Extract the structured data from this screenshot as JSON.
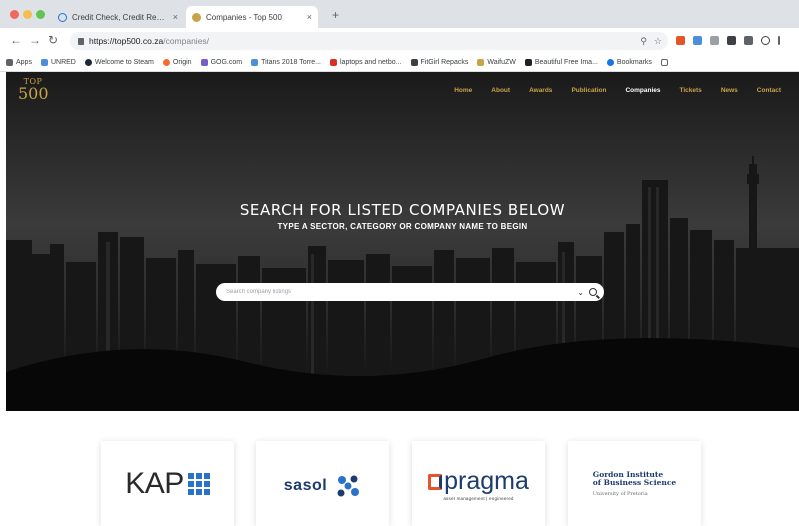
{
  "browser": {
    "tabs": [
      {
        "label": "Credit Check, Credit Report & ...",
        "active": false
      },
      {
        "label": "Companies - Top 500",
        "active": true
      }
    ],
    "close_glyph": "×",
    "new_tab_glyph": "+",
    "url_host": "https://top500.co.za",
    "url_path": "/companies/",
    "bookmarks": [
      "Apps",
      "UNRED",
      "Welcome to Steam",
      "Origin",
      "GOG.com",
      "Titans 2018 Torre...",
      "laptops and netbo...",
      "FitGirl Repacks",
      "WaifuZW",
      "Beautiful Free Ima...",
      "Bookmarks"
    ]
  },
  "site": {
    "logo_top": "TOP",
    "logo_num": "500",
    "nav": [
      "Home",
      "About",
      "Awards",
      "Publication",
      "Companies",
      "Tickets",
      "News",
      "Contact"
    ],
    "nav_current": "Companies",
    "hero_title": "SEARCH FOR LISTED COMPANIES BELOW",
    "hero_subtitle": "TYPE A SECTOR, CATEGORY OR COMPANY NAME TO BEGIN",
    "search_placeholder": "Search company listings",
    "accent_color": "#c9a24a"
  },
  "companies": [
    {
      "name": "KAP",
      "logo": "KAP"
    },
    {
      "name": "Sasol",
      "logo": "sasol"
    },
    {
      "name": "Pragma",
      "logo": "pragma",
      "tagline": "asset management | engineered"
    },
    {
      "name": "Gordon Institute of Business Science",
      "logo": "Gordon Institute\nof Business Science",
      "tagline": "University of Pretoria"
    }
  ]
}
